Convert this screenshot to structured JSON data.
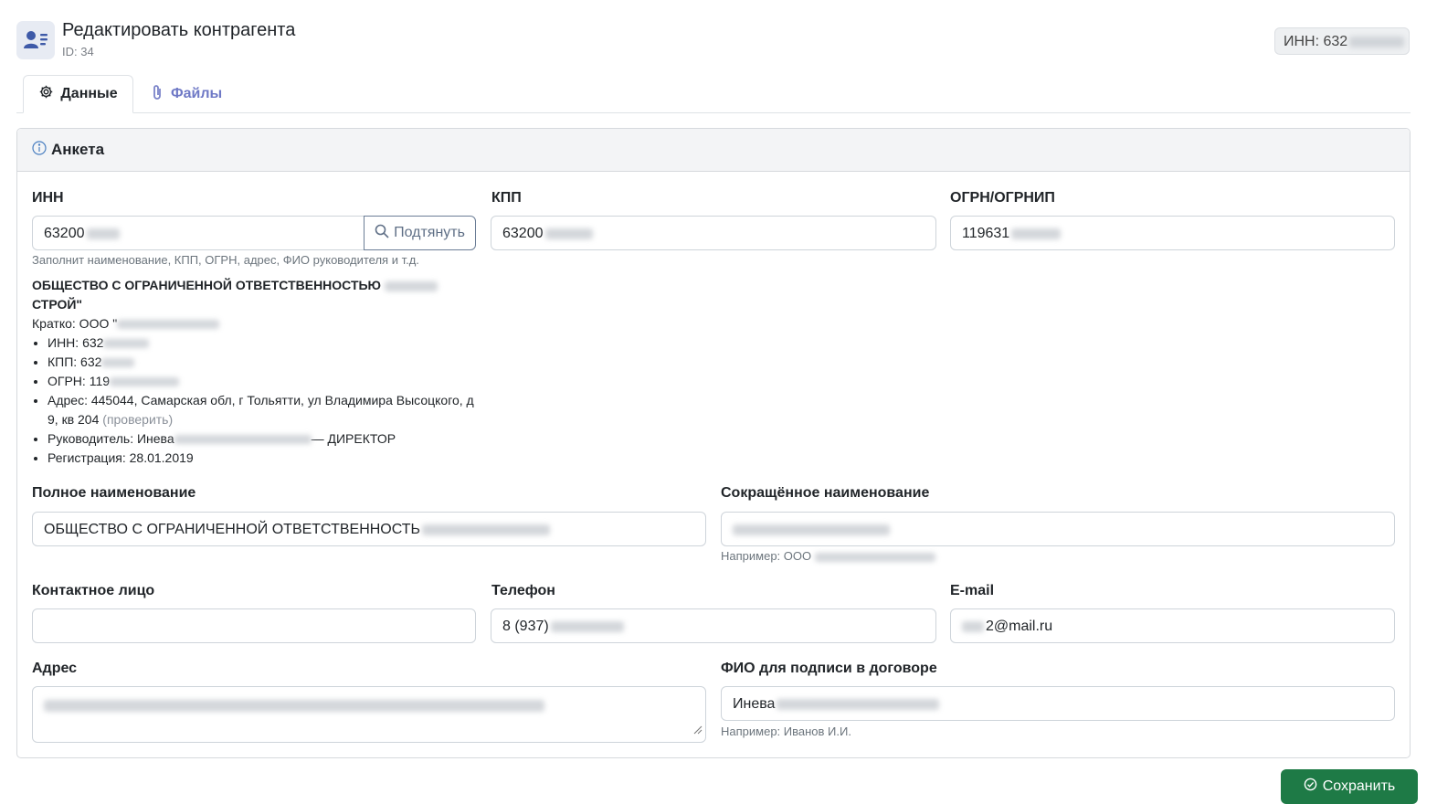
{
  "header": {
    "title": "Редактировать контрагента",
    "id_label": "ID: 34",
    "inn_badge": "ИНН: 632"
  },
  "tabs": [
    {
      "label": "Данные",
      "icon": "gear-icon",
      "active": true
    },
    {
      "label": "Файлы",
      "icon": "paperclip-icon",
      "active": false
    }
  ],
  "card": {
    "title": "Анкета",
    "icon": "info-circle-icon"
  },
  "fields": {
    "inn": {
      "label": "ИНН",
      "value": "63200"
    },
    "pull_button": "Подтянуть",
    "inn_hint": "Заполнит наименование, КПП, ОГРН, адрес, ФИО руководителя и т.д.",
    "kpp": {
      "label": "КПП",
      "value": "63200"
    },
    "ogrn": {
      "label": "ОГРН/ОГРНИП",
      "value": "119631"
    },
    "full_name": {
      "label": "Полное наименование",
      "value": "ОБЩЕСТВО С ОГРАНИЧЕННОЙ ОТВЕТСТВЕННОСТЬ"
    },
    "short_name": {
      "label": "Сокращённое наименование",
      "value": "",
      "hint": "Например: ООО"
    },
    "contact": {
      "label": "Контактное лицо",
      "value": ""
    },
    "phone": {
      "label": "Телефон",
      "value": "8 (937)"
    },
    "email": {
      "label": "E-mail",
      "value": "2@mail.ru"
    },
    "address": {
      "label": "Адрес",
      "value": ""
    },
    "signer": {
      "label": "ФИО для подписи в договоре",
      "value": "Инева",
      "hint": "Например: Иванов И.И."
    }
  },
  "lookup_result": {
    "org_line1": "ОБЩЕСТВО С ОГРАНИЧЕННОЙ ОТВЕТСТВЕННОСТЬЮ",
    "org_line2": "СТРОЙ\"",
    "short": "Кратко: ООО \"",
    "items": {
      "inn": "ИНН: 632",
      "kpp": "КПП: 632",
      "ogrn": "ОГРН: 119",
      "address": "Адрес: 445044, Самарская обл, г Тольятти, ул Владимира Высоцкого, д 9, кв 204",
      "address_check": "(проверить)",
      "director_prefix": "Руководитель: Инева",
      "director_suffix": "— ДИРЕКТОР",
      "registration": "Регистрация: 28.01.2019"
    }
  },
  "actions": {
    "save_label": "Сохранить"
  },
  "colors": {
    "accent": "#6f79c6",
    "save_button": "#1e7a46",
    "card_header": "#f3f4f6"
  }
}
